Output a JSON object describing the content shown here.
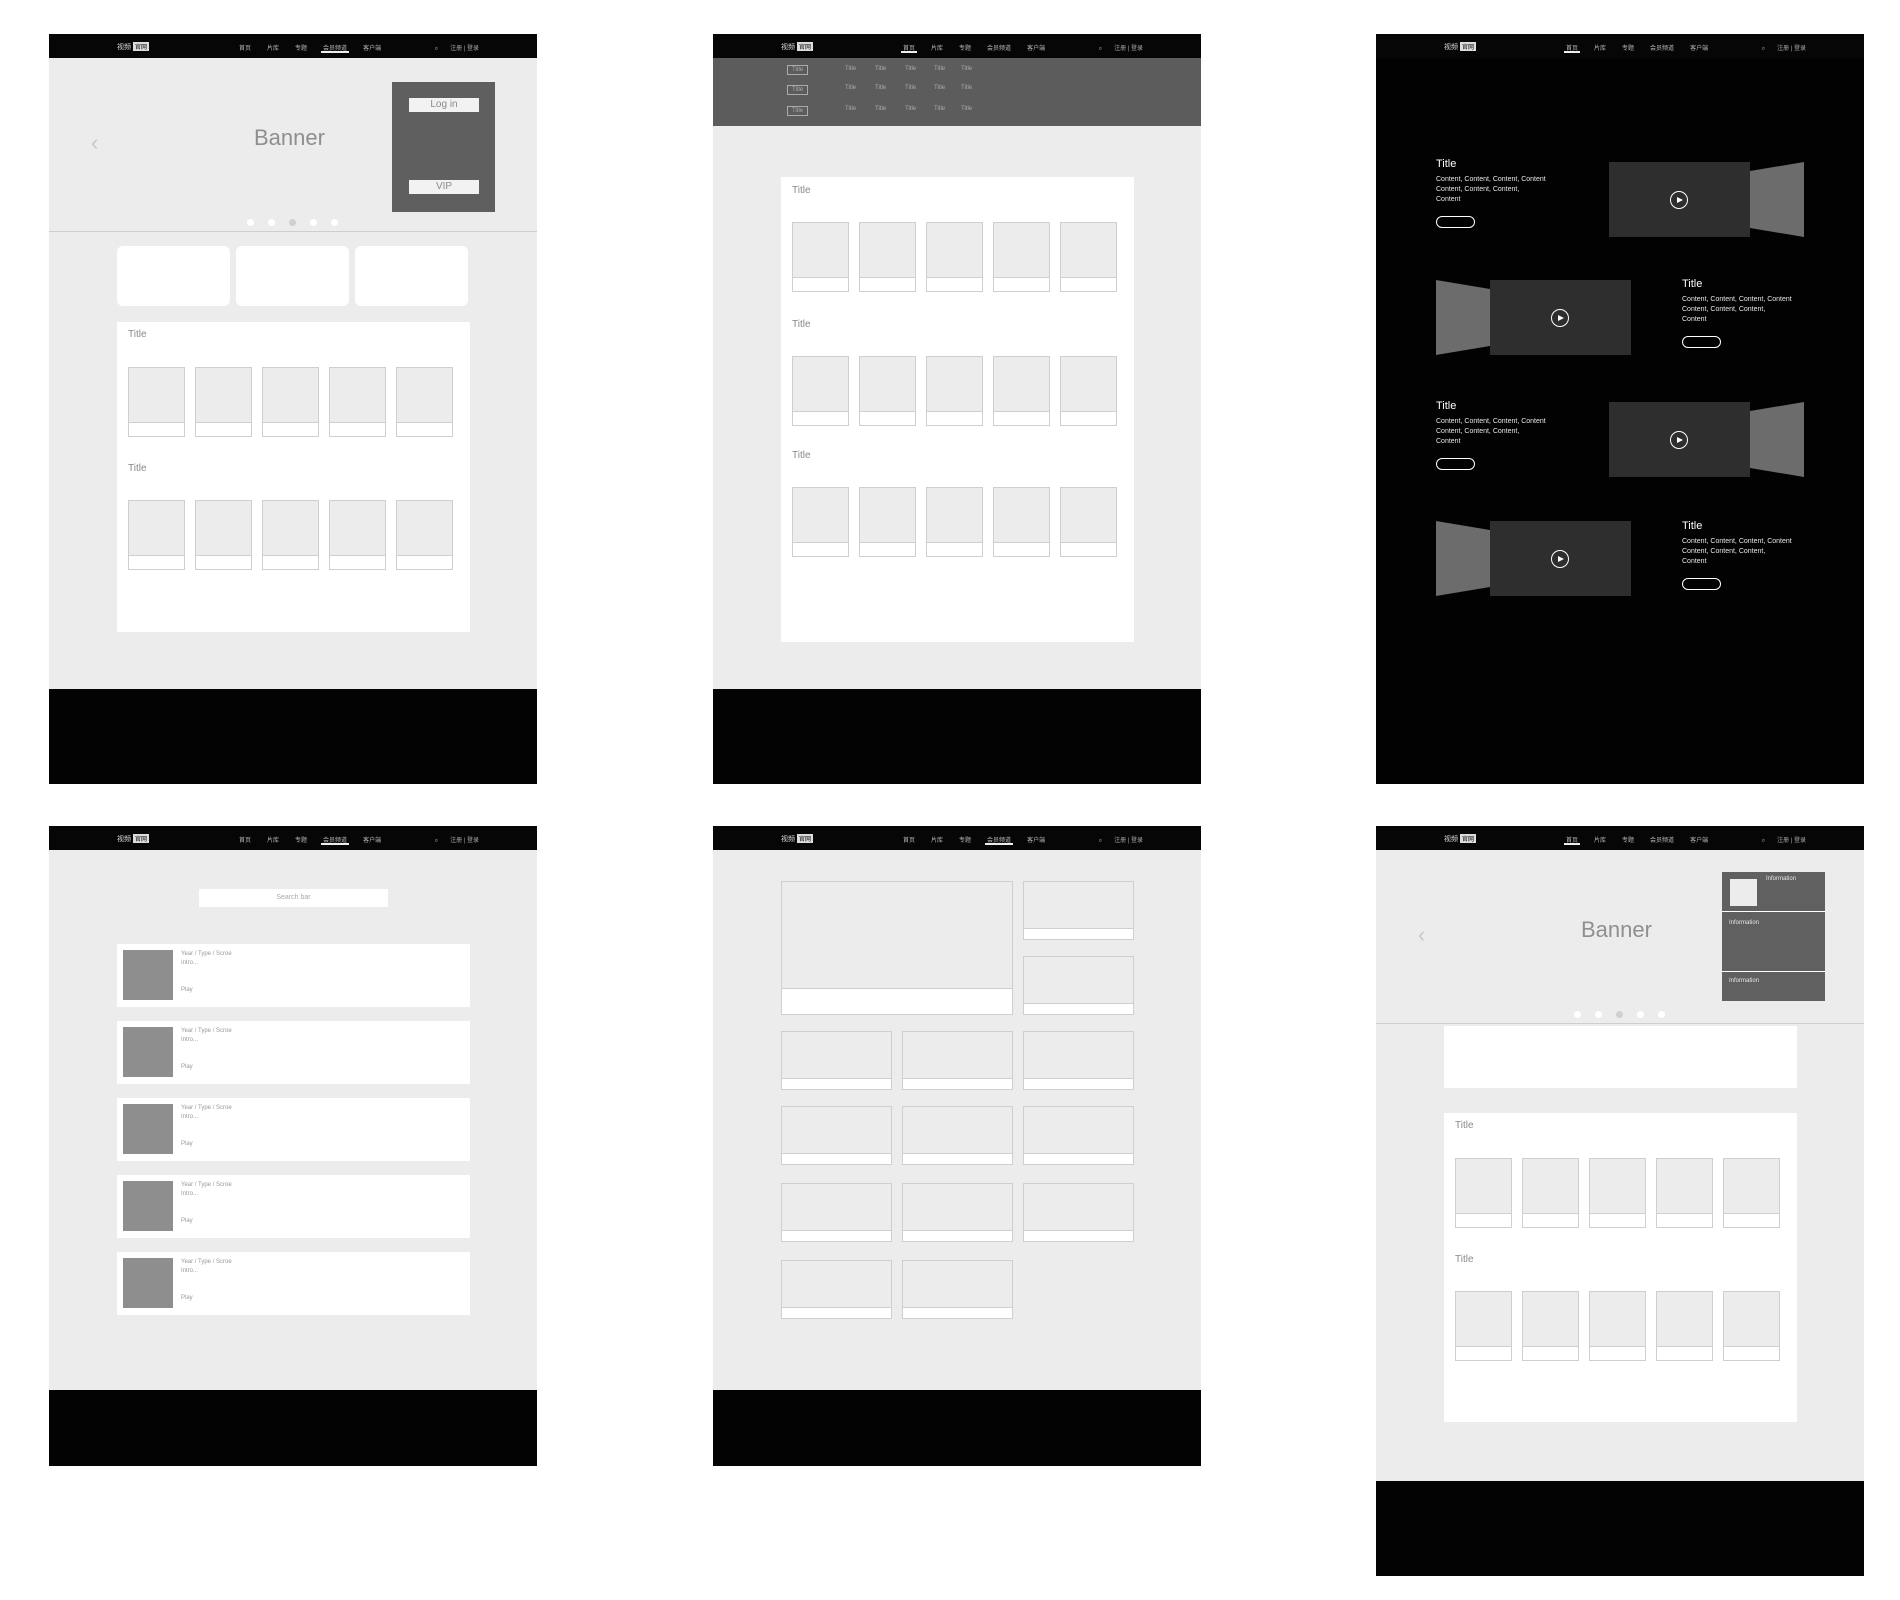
{
  "nav": {
    "logo": "视频",
    "logo_badge": "官网",
    "items": [
      "首页",
      "片库",
      "专题",
      "会员频道",
      "客户端"
    ],
    "search_icon": "search-icon",
    "account": "注册 | 登录"
  },
  "frame1": {
    "banner": "Banner",
    "login": "Log in",
    "vip": "VIP",
    "sections": [
      "Title",
      "Title"
    ]
  },
  "frame2": {
    "filter_labels": [
      "Title",
      "Title",
      "Title"
    ],
    "filter_options": [
      "Title",
      "Title",
      "Title",
      "Title",
      "Title"
    ],
    "sections": [
      "Title",
      "Title",
      "Title"
    ]
  },
  "frame3": {
    "title": "Title",
    "content_lines": [
      "Content, Content, Content, Content",
      "Content, Content, Content,",
      "Content"
    ]
  },
  "frame4": {
    "search_placeholder": "Search bar",
    "meta": "Year / Type / Scroe",
    "intro": "Intro...",
    "play": "Play"
  },
  "frame6": {
    "banner": "Banner",
    "info": "Information",
    "sections": [
      "Title",
      "Title"
    ]
  },
  "colors": {
    "nav_bg": "#060606",
    "page_bg": "#ececec",
    "footer_bg": "#030303",
    "panel_bg": "#ffffff",
    "dark_block": "#606060"
  }
}
